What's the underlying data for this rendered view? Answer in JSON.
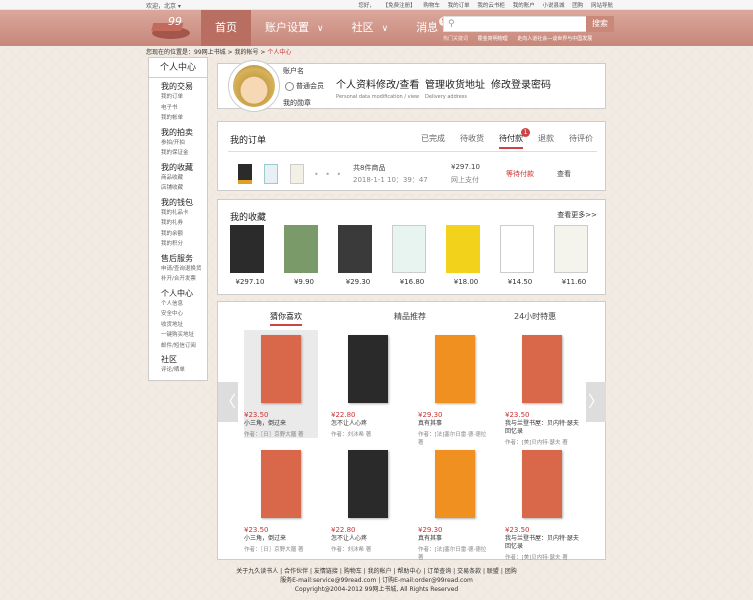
{
  "topbar": {
    "location": "欢迎，北京 ▾",
    "links": [
      "您好，",
      "【免费注册】",
      "购物车",
      "我的订单",
      "我的云书柜",
      "我的账户",
      "小说县城",
      "团购",
      "网站导航"
    ]
  },
  "header": {
    "nav": [
      "首页",
      "账户设置",
      "社区",
      "消息"
    ],
    "msg_badge": "5",
    "search_button": "搜索",
    "hot": [
      "热门关键词",
      "霍金简明物理",
      "走向人道社会—谈世界与中国发展"
    ]
  },
  "breadcrumb": {
    "prefix": "您现在的位置是：99网上书城",
    "sep1": " > ",
    "account": "我的帐号",
    "sep2": " > ",
    "current": "个人中心"
  },
  "sidebar": {
    "title": "个人中心",
    "groups": [
      {
        "title": "我的交易",
        "items": [
          "我的订单",
          "电子书",
          "我的帐单"
        ]
      },
      {
        "title": "我的拍卖",
        "items": [
          "参拍/开拍",
          "我的保证金"
        ]
      },
      {
        "title": "我的收藏",
        "items": [
          "商品收藏",
          "店铺收藏"
        ]
      },
      {
        "title": "我的钱包",
        "items": [
          "我的礼品卡",
          "我的礼券",
          "我的余额",
          "我的积分"
        ]
      },
      {
        "title": "售后服务",
        "items": [
          "申请/查询退换货",
          "补开/合开发票"
        ]
      },
      {
        "title": "个人中心",
        "items": [
          "个人信息",
          "安全中心",
          "收货地址",
          "一键购买地址",
          "邮件/短信订阅"
        ]
      },
      {
        "title": "社区",
        "items": [
          "评论/晒单"
        ]
      }
    ]
  },
  "profile": {
    "username": "账户名",
    "level": "普通会员",
    "medal": "我的勋章",
    "link1": "个人资料修改/查看",
    "link1_en": "Personal data modification / view",
    "link2": "管理收货地址",
    "link2_en": "Delivery address",
    "link3": "修改登录密码"
  },
  "orders": {
    "title": "我的订单",
    "tabs": [
      "已完成",
      "待收货",
      "待付款",
      "退款",
      "待评价"
    ],
    "tab_badge": "1",
    "dots": "• • •",
    "count": "共8件商品",
    "datetime": "2018-1-1  10：39：47",
    "price": "¥297.10",
    "payment": "网上支付",
    "status": "等待付款",
    "view": "查看"
  },
  "favorites": {
    "title": "我的收藏",
    "more": "查看更多>>",
    "prices": [
      "¥297.10",
      "¥9.90",
      "¥29.30",
      "¥16.80",
      "¥18.00",
      "¥14.50",
      "¥11.60"
    ],
    "colors": [
      "#2b2b2b",
      "#7a9a6a",
      "#3a3a3a",
      "#e8f4f0",
      "#f2d21a",
      "#ffffff",
      "#f4f4ec"
    ]
  },
  "recommend": {
    "tabs": [
      "猜你喜欢",
      "精品推荐",
      "24小时特惠"
    ],
    "left_arrow": "〈",
    "right_arrow": "〉",
    "books": [
      {
        "price": "¥23.50",
        "name": "小三角，倒过来",
        "author": "作者：［日］京野大膳 著",
        "color": "#d9684a"
      },
      {
        "price": "¥22.80",
        "name": "怎不让人心疼",
        "author": "作者：刘沐希 著",
        "color": "#2a2a2a"
      },
      {
        "price": "¥29.30",
        "name": "真有其事",
        "author": "作者：[法]塞尔日雷·德·德拉 著",
        "color": "#f09020"
      },
      {
        "price": "¥23.50",
        "name": "我与兰登书屋：贝内特·瑟夫回忆录",
        "author": "作者：[美]贝内特·瑟夫 著",
        "color": "#d9684a"
      },
      {
        "price": "¥23.50",
        "name": "小三角，倒过来",
        "author": "作者：［日］京野大膳 著",
        "color": "#d9684a"
      },
      {
        "price": "¥22.80",
        "name": "怎不让人心疼",
        "author": "作者：刘沐希 著",
        "color": "#2a2a2a"
      },
      {
        "price": "¥29.30",
        "name": "真有其事",
        "author": "作者：[法]塞尔日雷·德·德拉 著",
        "color": "#f09020"
      },
      {
        "price": "¥23.50",
        "name": "我与兰登书屋：贝内特·瑟夫回忆录",
        "author": "作者：[美]贝内特·瑟夫 著",
        "color": "#d9684a"
      }
    ]
  },
  "footer": {
    "line1": "关于九久读书人 | 合作伙伴 | 友情链接 | 购物车 | 我的帐户 | 帮助中心 | 订单查询 | 交易条款 | 联盟 | 团购",
    "line2": "服务E-mail:service@99read.com | 订购E-mail:order@99read.com",
    "line3": "Copyright@2004-2012 99网上书城, All Rights Reserved"
  }
}
